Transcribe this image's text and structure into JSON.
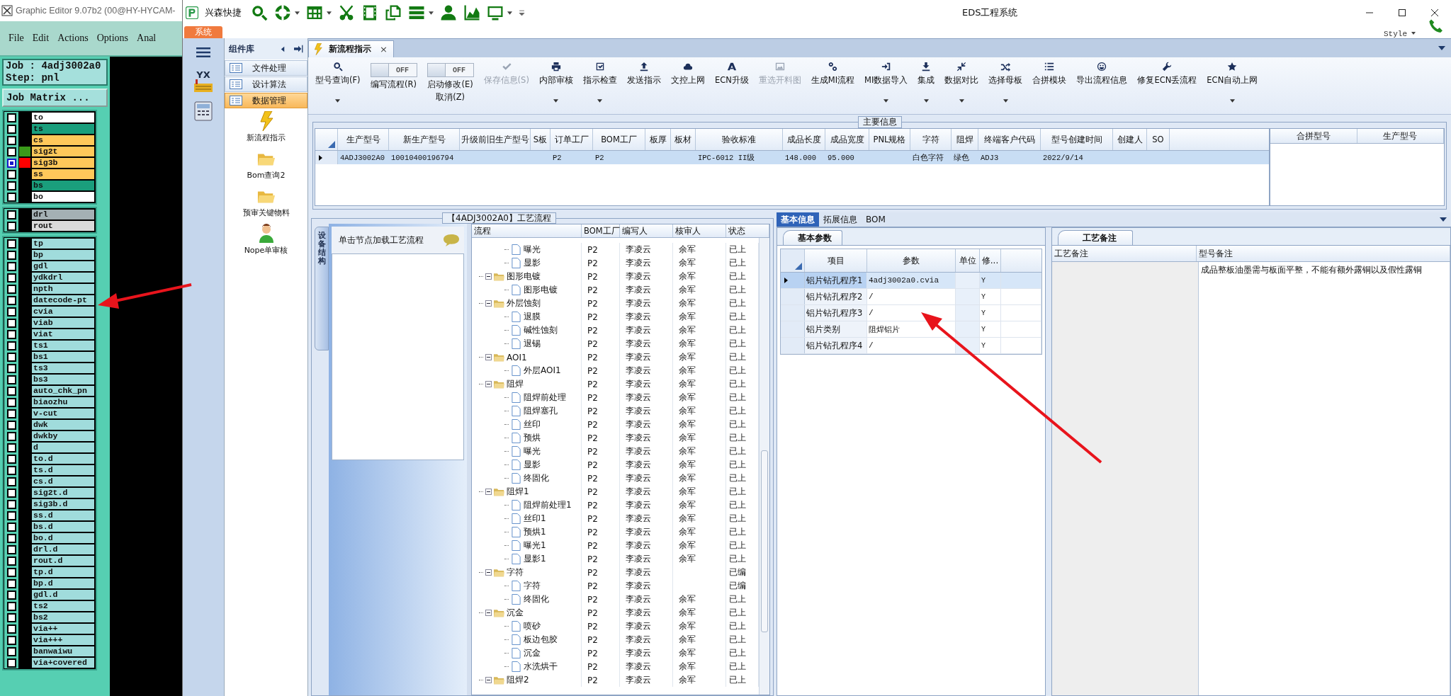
{
  "graphic_editor": {
    "title": "Graphic Editor 9.07b2 (00@HY-HYCAM-",
    "menu": [
      "File",
      "Edit",
      "Actions",
      "Options",
      "Anal"
    ],
    "job": "Job : 4adj3002a0",
    "step": "Step: pnl",
    "matrix_button": "Job Matrix ...",
    "layer_groups": [
      [
        {
          "name": "to",
          "color": "#ffffff",
          "selected": false
        },
        {
          "name": "ts",
          "color": "#1a9e7c",
          "selected": false
        },
        {
          "name": "cs",
          "color": "#ffc85a",
          "selected": false
        },
        {
          "name": "sig2t",
          "color": "#ffc85a",
          "swatch": {
            "color": "#3a9a1a"
          },
          "selected": false
        },
        {
          "name": "sig3b",
          "color": "#ffc85a",
          "swatch": {
            "color": "#ff0000"
          },
          "selected": true
        },
        {
          "name": "ss",
          "color": "#ffc85a",
          "selected": false
        },
        {
          "name": "bs",
          "color": "#1a9e7c",
          "selected": false
        },
        {
          "name": "bo",
          "color": "#ffffff",
          "selected": false
        }
      ],
      [
        {
          "name": "drl",
          "color": "#a4b0b4",
          "selected": false
        },
        {
          "name": "rout",
          "color": "#dadada",
          "selected": false
        }
      ],
      [
        {
          "name": "tp",
          "color": "#a0dcdc",
          "selected": false
        },
        {
          "name": "bp",
          "color": "#a0dcdc",
          "selected": false
        },
        {
          "name": "gdl",
          "color": "#a0dcdc",
          "selected": false
        },
        {
          "name": "ydkdrl",
          "color": "#a0dcdc",
          "selected": false
        },
        {
          "name": "npth",
          "color": "#a0dcdc",
          "selected": false
        },
        {
          "name": "datecode-pt",
          "color": "#a0dcdc",
          "selected": false
        },
        {
          "name": "cvia",
          "color": "#a0dcdc",
          "selected": false
        },
        {
          "name": "viab",
          "color": "#a0dcdc",
          "selected": false
        },
        {
          "name": "viat",
          "color": "#a0dcdc",
          "selected": false
        },
        {
          "name": "ts1",
          "color": "#a0dcdc",
          "selected": false
        },
        {
          "name": "bs1",
          "color": "#a0dcdc",
          "selected": false
        },
        {
          "name": "ts3",
          "color": "#a0dcdc",
          "selected": false
        },
        {
          "name": "bs3",
          "color": "#a0dcdc",
          "selected": false
        },
        {
          "name": "auto_chk_pn",
          "color": "#a0dcdc",
          "selected": false
        },
        {
          "name": "biaozhu",
          "color": "#a0dcdc",
          "selected": false
        },
        {
          "name": "v-cut",
          "color": "#a0dcdc",
          "selected": false
        },
        {
          "name": "dwk",
          "color": "#a0dcdc",
          "selected": false
        },
        {
          "name": "dwkby",
          "color": "#a0dcdc",
          "selected": false
        },
        {
          "name": "d",
          "color": "#a0dcdc",
          "selected": false
        },
        {
          "name": "to.d",
          "color": "#a0dcdc",
          "selected": false
        },
        {
          "name": "ts.d",
          "color": "#a0dcdc",
          "selected": false
        },
        {
          "name": "cs.d",
          "color": "#a0dcdc",
          "selected": false
        },
        {
          "name": "sig2t.d",
          "color": "#a0dcdc",
          "selected": false
        },
        {
          "name": "sig3b.d",
          "color": "#a0dcdc",
          "selected": false
        },
        {
          "name": "ss.d",
          "color": "#a0dcdc",
          "selected": false
        },
        {
          "name": "bs.d",
          "color": "#a0dcdc",
          "selected": false
        },
        {
          "name": "bo.d",
          "color": "#a0dcdc",
          "selected": false
        },
        {
          "name": "drl.d",
          "color": "#a0dcdc",
          "selected": false
        },
        {
          "name": "rout.d",
          "color": "#a0dcdc",
          "selected": false
        },
        {
          "name": "tp.d",
          "color": "#a0dcdc",
          "selected": false
        },
        {
          "name": "bp.d",
          "color": "#a0dcdc",
          "selected": false
        },
        {
          "name": "gdl.d",
          "color": "#a0dcdc",
          "selected": false
        },
        {
          "name": "ts2",
          "color": "#a0dcdc",
          "selected": false
        },
        {
          "name": "bs2",
          "color": "#a0dcdc",
          "selected": false
        },
        {
          "name": "via++",
          "color": "#a0dcdc",
          "selected": false
        },
        {
          "name": "via+++",
          "color": "#a0dcdc",
          "selected": false
        },
        {
          "name": "banwaiwu",
          "color": "#a0dcdc",
          "selected": false
        },
        {
          "name": "via+covered",
          "color": "#a0dcdc",
          "selected": false
        }
      ]
    ]
  },
  "eds": {
    "title": "EDS工程系统",
    "quick_label": "兴森快捷",
    "system_tab": "系统",
    "style_label": "Style",
    "nav_logo": "YX",
    "component_panel": {
      "title": "组件库",
      "items": [
        {
          "label": "文件处理",
          "selected": false
        },
        {
          "label": "设计算法",
          "selected": false
        },
        {
          "label": "数据管理",
          "selected": true
        }
      ],
      "tiles": [
        {
          "kind": "lightning",
          "label": "新流程指示"
        },
        {
          "kind": "folder",
          "label": "Bom查询2"
        },
        {
          "kind": "folder",
          "label": "预审关键物料"
        },
        {
          "kind": "person",
          "label": "Nope单审核"
        }
      ]
    },
    "document_tab": {
      "label": "新流程指示",
      "close": "×"
    },
    "ribbon": [
      {
        "kind": "button",
        "label": "型号查询(F)",
        "dropdown": true,
        "disabled": false
      },
      {
        "kind": "toggle",
        "label": "编写流程(R)",
        "state_text": "OFF",
        "on": false
      },
      {
        "kind": "toggle",
        "label": "启动修改(E)",
        "label2": "取消(Z)",
        "state_text": "OFF",
        "on": false
      },
      {
        "kind": "button",
        "label": "保存信息(S)",
        "dropdown": false,
        "disabled": true
      },
      {
        "kind": "button",
        "label": "内部审核",
        "dropdown": true,
        "disabled": false
      },
      {
        "kind": "button",
        "label": "指示检查",
        "dropdown": true,
        "disabled": false
      },
      {
        "kind": "button",
        "label": "发送指示",
        "dropdown": false,
        "disabled": false
      },
      {
        "kind": "button",
        "label": "文控上网",
        "dropdown": false,
        "disabled": false
      },
      {
        "kind": "button",
        "label": "ECN升级",
        "dropdown": false,
        "disabled": false
      },
      {
        "kind": "button",
        "label": "重选开料图",
        "dropdown": false,
        "disabled": true
      },
      {
        "kind": "button",
        "label": "生成MI流程",
        "dropdown": false,
        "disabled": false
      },
      {
        "kind": "button",
        "label": "MI数据导入",
        "dropdown": true,
        "disabled": false
      },
      {
        "kind": "button",
        "label": "集成",
        "dropdown": true,
        "disabled": false
      },
      {
        "kind": "button",
        "label": "数据对比",
        "dropdown": true,
        "disabled": false
      },
      {
        "kind": "button",
        "label": "选择母板",
        "dropdown": true,
        "disabled": false
      },
      {
        "kind": "button",
        "label": "合拼模块",
        "dropdown": false,
        "disabled": false
      },
      {
        "kind": "button",
        "label": "导出流程信息",
        "dropdown": false,
        "disabled": false
      },
      {
        "kind": "button",
        "label": "修复ECN丢流程",
        "dropdown": false,
        "disabled": false
      },
      {
        "kind": "button",
        "label": "ECN自动上网",
        "dropdown": true,
        "disabled": false
      }
    ],
    "main_info": {
      "title": "主要信息",
      "columns": [
        "生产型号",
        "新生产型号",
        "升级前旧生产型号",
        "S板",
        "订单工厂",
        "BOM工厂",
        "板厚",
        "板材",
        "验收标准",
        "成品长度",
        "成品宽度",
        "PNL规格",
        "字符",
        "阻焊",
        "终端客户代码",
        "型号创建时间",
        "创建人",
        "SO"
      ],
      "rows": [
        {
          "selected": true,
          "cells": [
            "4ADJ3002A0",
            "10010400196794",
            null,
            null,
            "P2",
            "P2",
            null,
            null,
            "IPC-6012 II级",
            "148.000",
            "95.000",
            null,
            "白色字符",
            "绿色",
            "ADJ3",
            "2022/9/14",
            null,
            null
          ]
        }
      ],
      "side_columns": [
        "合拼型号",
        "生产型号"
      ]
    },
    "flow": {
      "title": "【4ADJ3002A0】工艺流程",
      "side_tab": "设备结构",
      "hint": "单击节点加载工艺流程",
      "columns": [
        "流程",
        "BOM工厂",
        "编写人",
        "核审人",
        "状态"
      ],
      "tree": [
        {
          "children": [
            {
              "kind": "step",
              "label": "曝光",
              "bom": "P2",
              "author": "李凌云",
              "reviewer": "余军",
              "status": "已上"
            },
            {
              "kind": "step",
              "label": "显影",
              "bom": "P2",
              "author": "李凌云",
              "reviewer": "余军",
              "status": "已上"
            }
          ]
        },
        {
          "kind": "folder",
          "label": "图形电镀",
          "bom": "P2",
          "author": "李凌云",
          "reviewer": "余军",
          "status": "已上",
          "expanded": true,
          "children": [
            {
              "kind": "step",
              "label": "图形电镀",
              "bom": "P2",
              "author": "李凌云",
              "reviewer": "余军",
              "status": "已上"
            }
          ]
        },
        {
          "kind": "folder",
          "label": "外层蚀刻",
          "bom": "P2",
          "author": "李凌云",
          "reviewer": "余军",
          "status": "已上",
          "expanded": true,
          "children": [
            {
              "kind": "step",
              "label": "退膜",
              "bom": "P2",
              "author": "李凌云",
              "reviewer": "余军",
              "status": "已上"
            },
            {
              "kind": "step",
              "label": "碱性蚀刻",
              "bom": "P2",
              "author": "李凌云",
              "reviewer": "余军",
              "status": "已上"
            },
            {
              "kind": "step",
              "label": "退锡",
              "bom": "P2",
              "author": "李凌云",
              "reviewer": "余军",
              "status": "已上"
            }
          ]
        },
        {
          "kind": "folder",
          "label": "AOI1",
          "bom": "P2",
          "author": "李凌云",
          "reviewer": "余军",
          "status": "已上",
          "expanded": true,
          "children": [
            {
              "kind": "step",
              "label": "外层AOI1",
              "bom": "P2",
              "author": "李凌云",
              "reviewer": "余军",
              "status": "已上"
            }
          ]
        },
        {
          "kind": "folder",
          "label": "阻焊",
          "bom": "P2",
          "author": "李凌云",
          "reviewer": "余军",
          "status": "已上",
          "expanded": true,
          "children": [
            {
              "kind": "step",
              "label": "阻焊前处理",
              "bom": "P2",
              "author": "李凌云",
              "reviewer": "余军",
              "status": "已上"
            },
            {
              "kind": "step",
              "label": "阻焊塞孔",
              "bom": "P2",
              "author": "李凌云",
              "reviewer": "余军",
              "status": "已上"
            },
            {
              "kind": "step",
              "label": "丝印",
              "bom": "P2",
              "author": "李凌云",
              "reviewer": "余军",
              "status": "已上"
            },
            {
              "kind": "step",
              "label": "预烘",
              "bom": "P2",
              "author": "李凌云",
              "reviewer": "余军",
              "status": "已上"
            },
            {
              "kind": "step",
              "label": "曝光",
              "bom": "P2",
              "author": "李凌云",
              "reviewer": "余军",
              "status": "已上"
            },
            {
              "kind": "step",
              "label": "显影",
              "bom": "P2",
              "author": "李凌云",
              "reviewer": "余军",
              "status": "已上"
            },
            {
              "kind": "step",
              "label": "终固化",
              "bom": "P2",
              "author": "李凌云",
              "reviewer": "余军",
              "status": "已上"
            }
          ]
        },
        {
          "kind": "folder",
          "label": "阻焊1",
          "bom": "P2",
          "author": "李凌云",
          "reviewer": "余军",
          "status": "已上",
          "expanded": true,
          "children": [
            {
              "kind": "step",
              "label": "阻焊前处理1",
              "bom": "P2",
              "author": "李凌云",
              "reviewer": "余军",
              "status": "已上"
            },
            {
              "kind": "step",
              "label": "丝印1",
              "bom": "P2",
              "author": "李凌云",
              "reviewer": "余军",
              "status": "已上"
            },
            {
              "kind": "step",
              "label": "预烘1",
              "bom": "P2",
              "author": "李凌云",
              "reviewer": "余军",
              "status": "已上"
            },
            {
              "kind": "step",
              "label": "曝光1",
              "bom": "P2",
              "author": "李凌云",
              "reviewer": "余军",
              "status": "已上"
            },
            {
              "kind": "step",
              "label": "显影1",
              "bom": "P2",
              "author": "李凌云",
              "reviewer": "余军",
              "status": "已上"
            }
          ]
        },
        {
          "kind": "folder",
          "label": "字符",
          "bom": "P2",
          "author": "李凌云",
          "status": "已编",
          "expanded": true,
          "children": [
            {
              "kind": "step",
              "label": "字符",
              "bom": "P2",
              "author": "李凌云",
              "status": "已编"
            },
            {
              "kind": "step",
              "label": "终固化",
              "bom": "P2",
              "author": "李凌云",
              "reviewer": "余军",
              "status": "已上"
            }
          ]
        },
        {
          "kind": "folder",
          "label": "沉金",
          "bom": "P2",
          "author": "李凌云",
          "reviewer": "余军",
          "status": "已上",
          "expanded": true,
          "children": [
            {
              "kind": "step",
              "label": "喷砂",
              "bom": "P2",
              "author": "李凌云",
              "reviewer": "余军",
              "status": "已上"
            },
            {
              "kind": "step",
              "label": "板边包胶",
              "bom": "P2",
              "author": "李凌云",
              "reviewer": "余军",
              "status": "已上"
            },
            {
              "kind": "step",
              "label": "沉金",
              "bom": "P2",
              "author": "李凌云",
              "reviewer": "余军",
              "status": "已上"
            },
            {
              "kind": "step",
              "label": "水洗烘干",
              "bom": "P2",
              "author": "李凌云",
              "reviewer": "余军",
              "status": "已上"
            }
          ]
        },
        {
          "kind": "folder",
          "label": "阻焊2",
          "bom": "P2",
          "author": "李凌云",
          "reviewer": "余军",
          "status": "已上",
          "expanded": true
        }
      ]
    },
    "details": {
      "tabs": [
        {
          "label": "基本信息",
          "selected": true
        },
        {
          "label": "拓展信息",
          "selected": false
        },
        {
          "label": "BOM",
          "selected": false
        }
      ],
      "params": {
        "tab": "基本参数",
        "columns": [
          "项目",
          "参数",
          "单位",
          "修..."
        ],
        "rows": [
          {
            "item": "铝片钻孔程序1",
            "value": "4adj3002a0.cvia",
            "flag": "Y",
            "selected": true
          },
          {
            "item": "铝片钻孔程序2",
            "value": "/",
            "flag": "Y",
            "selected": false
          },
          {
            "item": "铝片钻孔程序3",
            "value": "/",
            "flag": "Y",
            "selected": false
          },
          {
            "item": "铝片类别",
            "value": "阻焊铝片",
            "flag": "Y",
            "selected": false
          },
          {
            "item": "铝片钻孔程序4",
            "value": "/",
            "flag": "Y",
            "selected": false
          }
        ]
      },
      "notes": {
        "tab": "工艺备注",
        "columns": [
          "工艺备注",
          "型号备注"
        ],
        "rows": [
          {
            "model_note": "成品整板油墨需与板面平整，不能有额外露铜以及假性露铜"
          }
        ]
      }
    }
  }
}
